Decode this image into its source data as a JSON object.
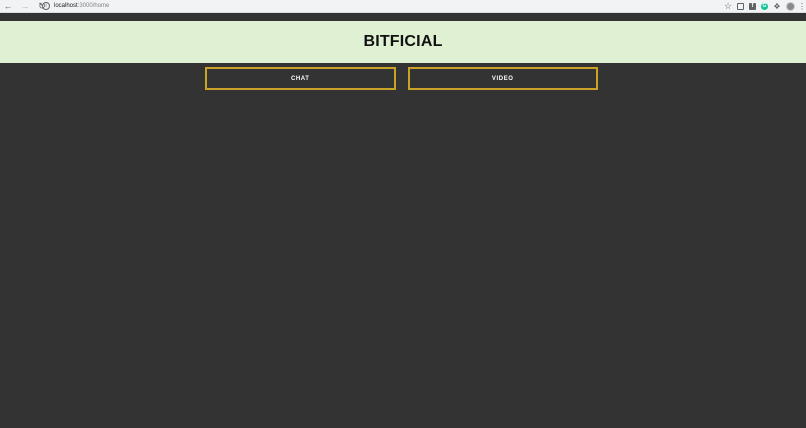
{
  "browser": {
    "url_host": "localhost",
    "url_path": ":3000/home",
    "icons": [
      "back-arrow-icon",
      "forward-arrow-icon",
      "reload-icon",
      "info-icon",
      "star-icon",
      "extension-icon",
      "facebook-icon",
      "grammarly-icon",
      "puzzle-icon",
      "avatar",
      "menu-icon"
    ]
  },
  "header": {
    "title": "BITFICIAL",
    "background": "#dff0d3"
  },
  "nav": {
    "chat_label": "CHAT",
    "video_label": "VIDEO",
    "border_color": "#c9a227"
  },
  "page": {
    "background": "#333333"
  }
}
